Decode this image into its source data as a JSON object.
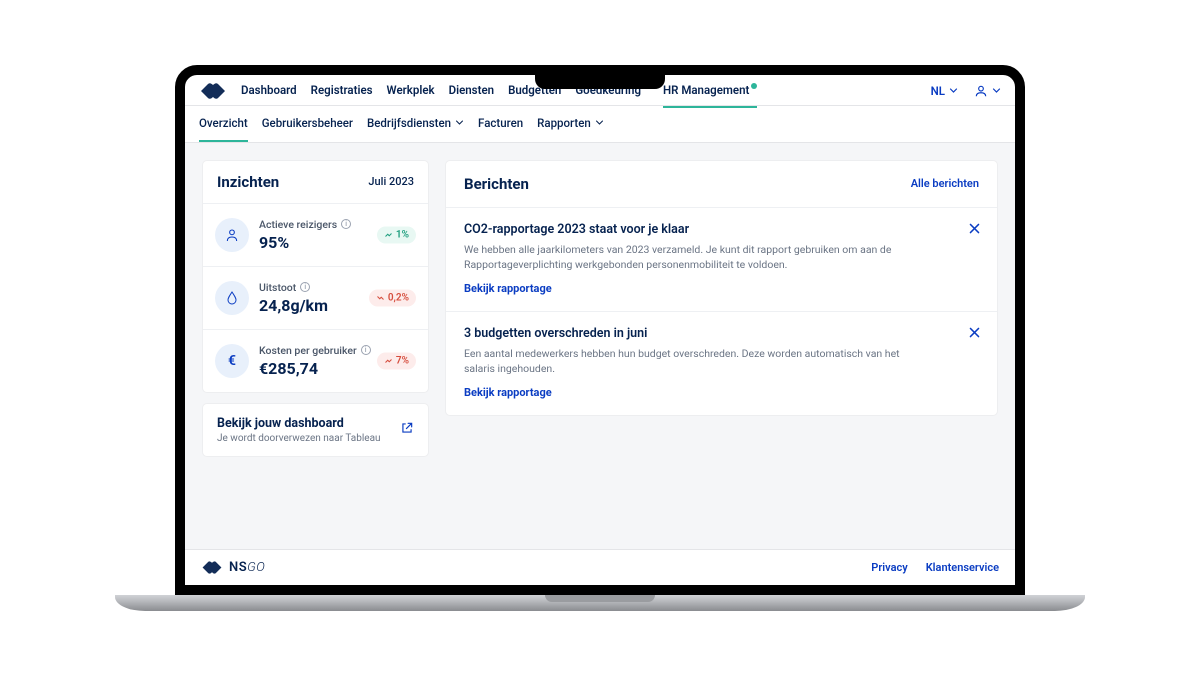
{
  "nav": {
    "tabs": [
      {
        "label": "Dashboard"
      },
      {
        "label": "Registraties"
      },
      {
        "label": "Werkplek"
      },
      {
        "label": "Diensten"
      },
      {
        "label": "Budgetten"
      },
      {
        "label": "Goedkeuring",
        "dot": true
      },
      {
        "label": "HR Management",
        "dot": true,
        "active": true
      }
    ],
    "lang": "NL"
  },
  "subnav": {
    "tabs": [
      {
        "label": "Overzicht",
        "active": true
      },
      {
        "label": "Gebruikersbeheer"
      },
      {
        "label": "Bedrijfsdiensten",
        "chev": true
      },
      {
        "label": "Facturen"
      },
      {
        "label": "Rapporten",
        "chev": true
      }
    ]
  },
  "insights": {
    "title": "Inzichten",
    "period": "Juli 2023",
    "metrics": [
      {
        "label": "Actieve reizigers",
        "value": "95%",
        "delta": "1%",
        "dir": "up"
      },
      {
        "label": "Uitstoot",
        "value": "24,8g/km",
        "delta": "0,2%",
        "dir": "down"
      },
      {
        "label": "Kosten per gebruiker",
        "value": "€285,74",
        "delta": "7%",
        "dir": "down-red"
      }
    ],
    "dashboard_link": {
      "title": "Bekijk jouw dashboard",
      "sub": "Je wordt doorverwezen naar Tableau"
    }
  },
  "messages": {
    "title": "Berichten",
    "all_label": "Alle berichten",
    "items": [
      {
        "title": "CO2-rapportage 2023 staat voor je klaar",
        "body": "We hebben alle jaarkilometers van 2023 verzameld. Je kunt dit rapport gebruiken om aan de Rapportageverplichting werkgebonden personenmobiliteit te voldoen.",
        "action": "Bekijk rapportage"
      },
      {
        "title": "3 budgetten overschreden in juni",
        "body": "Een aantal medewerkers hebben hun budget overschreden. Deze worden automatisch van het salaris ingehouden.",
        "action": "Bekijk rapportage"
      }
    ]
  },
  "footer": {
    "brand_main": "NS",
    "brand_sub": "GO",
    "links": [
      {
        "label": "Privacy"
      },
      {
        "label": "Klantenservice"
      }
    ]
  }
}
